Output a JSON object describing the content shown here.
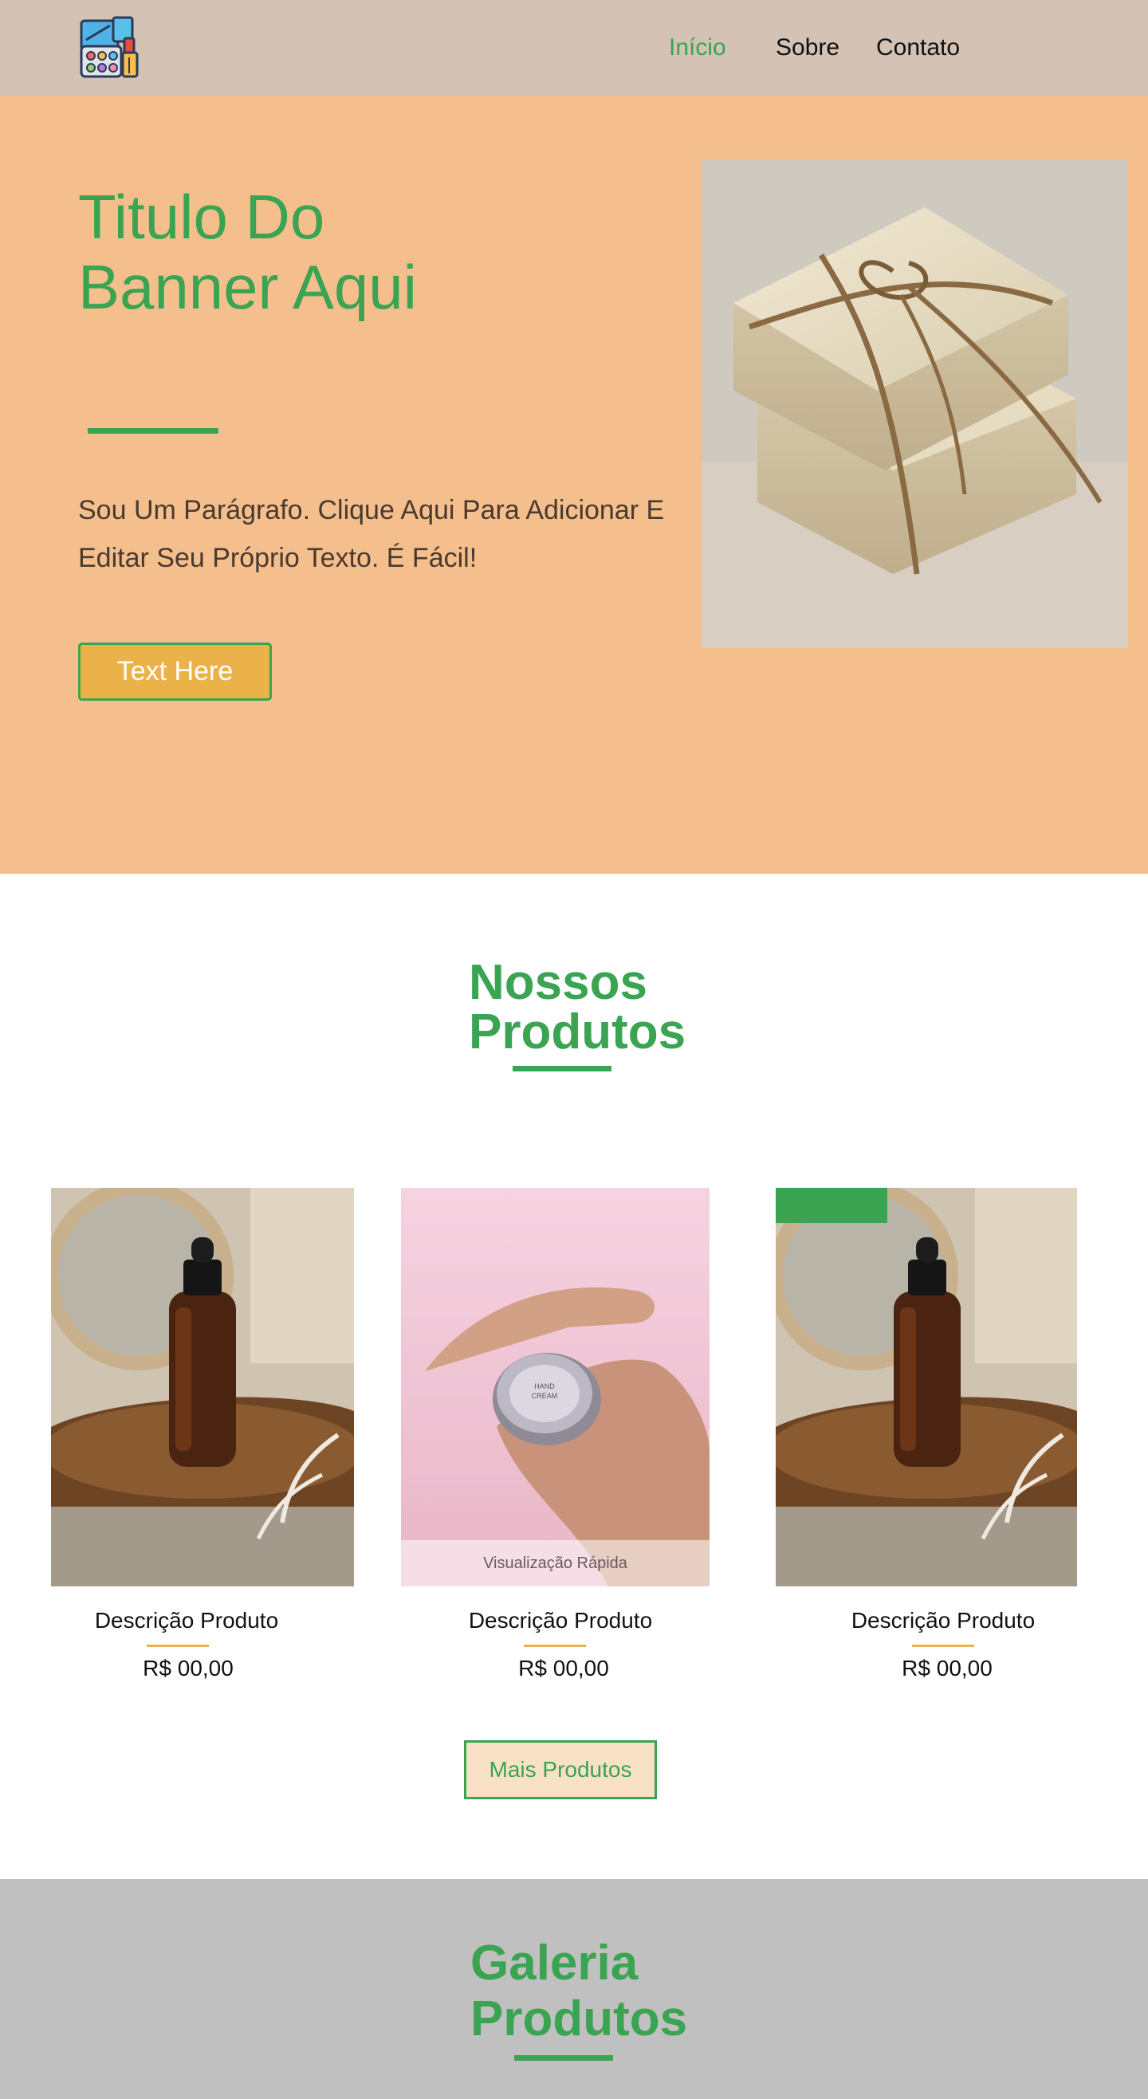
{
  "header": {
    "logo_icon": "makeup-palette-icon",
    "nav": [
      {
        "label": "Início",
        "active": true
      },
      {
        "label": "Sobre",
        "active": false
      },
      {
        "label": "Contato",
        "active": false
      }
    ]
  },
  "hero": {
    "title_line1": "Titulo Do",
    "title_line2": "Banner Aqui",
    "paragraph_line1": "Sou Um Parágrafo. Clique Aqui Para Adicionar E",
    "paragraph_line2": "Editar Seu Próprio Texto. É Fácil!",
    "button_label": "Text Here",
    "image": "soap-bars-tied-with-twine"
  },
  "products": {
    "title_line1": "Nossos",
    "title_line2": "Produtos",
    "items": [
      {
        "name": "Descrição Produto",
        "price": "R$ 00,00",
        "image": "amber-dropper-bottle"
      },
      {
        "name": "Descrição Produto",
        "price": "R$ 00,00",
        "image": "hand-cream-tin",
        "quick_view": "Visualização Rápida"
      },
      {
        "name": "Descrição Produto",
        "price": "R$ 00,00",
        "image": "amber-dropper-bottle"
      }
    ],
    "more_button": "Mais Produtos"
  },
  "gallery": {
    "title_line1": "Galeria",
    "title_line2": "Produtos"
  },
  "colors": {
    "accent_green": "#3aa452",
    "accent_gold": "#ecb24a",
    "header_bg": "#d4c2b4",
    "hero_bg": "#f5bf8d",
    "gallery_bg": "#c0c0c0"
  }
}
